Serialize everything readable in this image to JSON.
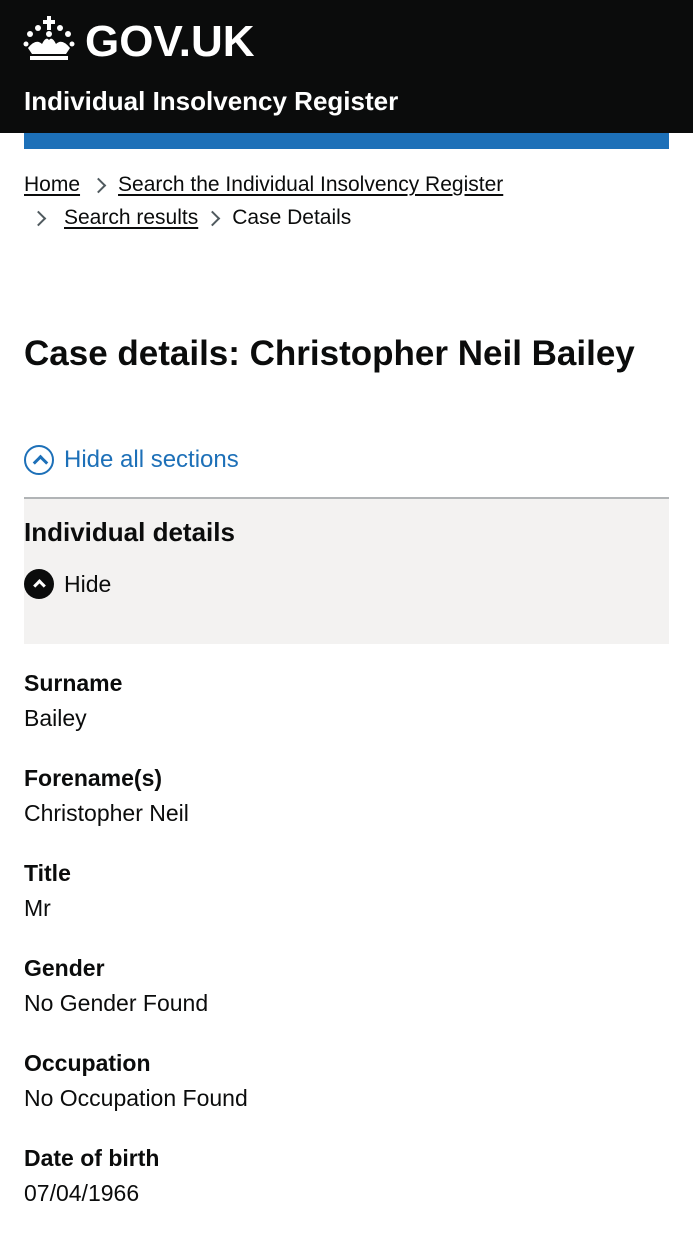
{
  "header": {
    "brand": "GOV.UK",
    "service_name": "Individual Insolvency Register"
  },
  "breadcrumbs": [
    {
      "label": "Home"
    },
    {
      "label": "Search the Individual Insolvency Register"
    },
    {
      "label": "Search results"
    },
    {
      "label": "Case Details"
    }
  ],
  "page_title": "Case details: Christopher Neil Bailey",
  "toggle_all_label": "Hide all sections",
  "section": {
    "title": "Individual details",
    "toggle_label": "Hide"
  },
  "details": [
    {
      "label": "Surname",
      "value": "Bailey"
    },
    {
      "label": "Forename(s)",
      "value": "Christopher Neil"
    },
    {
      "label": "Title",
      "value": "Mr"
    },
    {
      "label": "Gender",
      "value": "No Gender Found"
    },
    {
      "label": "Occupation",
      "value": "No Occupation Found"
    },
    {
      "label": "Date of birth",
      "value": "07/04/1966"
    }
  ],
  "colors": {
    "header_bg": "#0b0c0c",
    "brand_blue": "#1d70b8",
    "section_bg": "#f3f2f1"
  }
}
